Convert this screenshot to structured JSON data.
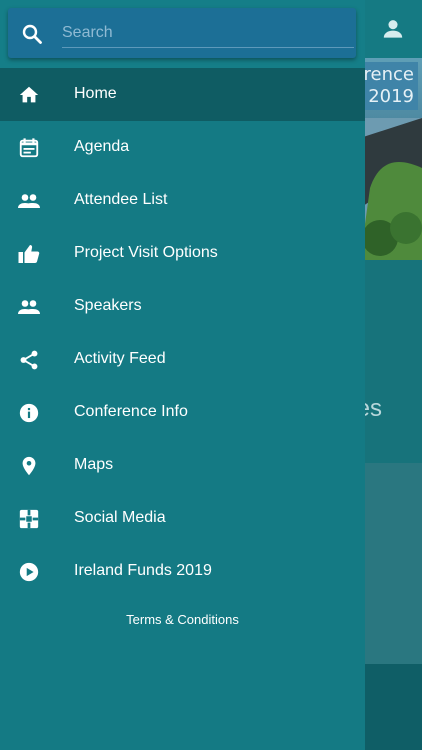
{
  "background": {
    "banner_text_line1": "rence",
    "banner_text_line2": "2019",
    "section_text": "es"
  },
  "search": {
    "placeholder": "Search",
    "icon": "search-icon"
  },
  "menu": {
    "items": [
      {
        "label": "Home",
        "icon": "home-icon",
        "active": true
      },
      {
        "label": "Agenda",
        "icon": "calendar-icon"
      },
      {
        "label": "Attendee List",
        "icon": "people-icon"
      },
      {
        "label": "Project Visit Options",
        "icon": "thumbs-up-icon"
      },
      {
        "label": "Speakers",
        "icon": "people-icon"
      },
      {
        "label": "Activity Feed",
        "icon": "share-icon"
      },
      {
        "label": "Conference Info",
        "icon": "info-icon"
      },
      {
        "label": "Maps",
        "icon": "map-pin-icon"
      },
      {
        "label": "Social Media",
        "icon": "social-icon"
      },
      {
        "label": "Ireland Funds 2019",
        "icon": "play-icon"
      }
    ]
  },
  "footer": {
    "terms_label": "Terms & Conditions"
  },
  "colors": {
    "drawer": "#147a84",
    "active_item": "#0f5c63",
    "search_box": "#1c6f96"
  }
}
